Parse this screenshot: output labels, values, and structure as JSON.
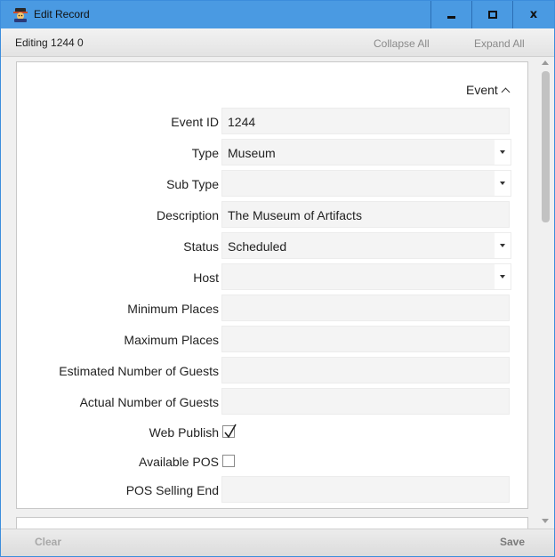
{
  "window": {
    "title": "Edit Record",
    "close_glyph": "x",
    "icons": [
      "app-icon",
      "minimize-icon",
      "maximize-icon",
      "close-icon"
    ]
  },
  "toolbar": {
    "editing": "Editing 1244 0",
    "collapse_all": "Collapse All",
    "expand_all": "Expand All"
  },
  "section": {
    "title": "Event",
    "expanded": true
  },
  "fields": {
    "event_id": {
      "label": "Event ID",
      "value": "1244"
    },
    "type": {
      "label": "Type",
      "value": "Museum"
    },
    "sub_type": {
      "label": "Sub Type",
      "value": ""
    },
    "description": {
      "label": "Description",
      "value": "The Museum of Artifacts"
    },
    "status": {
      "label": "Status",
      "value": "Scheduled"
    },
    "host": {
      "label": "Host",
      "value": ""
    },
    "minimum_places": {
      "label": "Minimum Places",
      "value": ""
    },
    "maximum_places": {
      "label": "Maximum Places",
      "value": ""
    },
    "estimated_guests": {
      "label": "Estimated Number of Guests",
      "value": ""
    },
    "actual_guests": {
      "label": "Actual Number of Guests",
      "value": ""
    },
    "web_publish": {
      "label": "Web Publish",
      "checked": true
    },
    "available_pos": {
      "label": "Available POS",
      "checked": false
    },
    "pos_selling_end": {
      "label": "POS Selling End",
      "value": ""
    }
  },
  "footer": {
    "clear": "Clear",
    "save": "Save"
  },
  "colors": {
    "titlebar": "#4a9ae2",
    "panel_bg": "#f0f0f0",
    "field_bg": "#f4f4f4"
  }
}
